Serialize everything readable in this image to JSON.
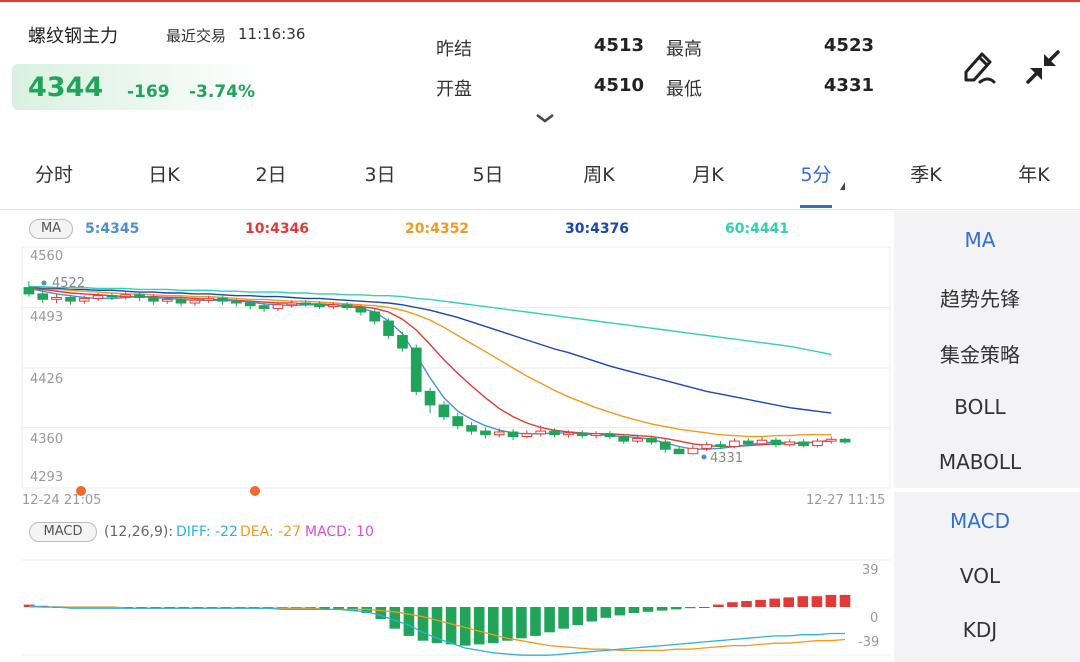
{
  "header": {
    "title": "螺纹钢主力",
    "last_trade_label": "最近交易",
    "last_trade_time": "11:16:36",
    "price": "4344",
    "change": "-169",
    "change_pct": "-3.74%",
    "stats": {
      "prev_settle_label": "昨结",
      "prev_settle_value": "4513",
      "high_label": "最高",
      "high_value": "4523",
      "open_label": "开盘",
      "open_value": "4510",
      "low_label": "最低",
      "low_value": "4331"
    }
  },
  "tabs": [
    "分时",
    "日K",
    "2日",
    "3日",
    "5日",
    "周K",
    "月K",
    "5分",
    "季K",
    "年K"
  ],
  "active_tab": "5分",
  "ma_legend": {
    "badge": "MA",
    "ma5": "5:4345",
    "ma10": "10:4346",
    "ma20": "20:4352",
    "ma30": "30:4376",
    "ma60": "60:4441"
  },
  "price_axis": [
    "4560",
    "4493",
    "4426",
    "4360",
    "4293"
  ],
  "time_axis": {
    "start": "12-24 21:05",
    "end": "12-27 11:15"
  },
  "annotations": {
    "high_mark": "4522",
    "low_mark": "4331"
  },
  "macd": {
    "badge": "MACD",
    "params": "(12,26,9):",
    "diff": "DIFF: -22",
    "dea": "DEA: -27",
    "macd": "MACD: 10",
    "axis": [
      "39",
      "0",
      "-39"
    ]
  },
  "side_panel": {
    "indicators": [
      "MA",
      "趋势先锋",
      "集金策略",
      "BOLL",
      "MABOLL"
    ],
    "sub_indicators": [
      "MACD",
      "VOL",
      "KDJ"
    ],
    "active_indicator": "MA",
    "active_sub_indicator": "MACD"
  },
  "colors": {
    "up": "#e53935",
    "down": "#1fa45a",
    "ma5": "#4a90d9",
    "ma10": "#e53935",
    "ma20": "#f29a1f",
    "ma30": "#1a47b8",
    "ma60": "#2fd3b0",
    "accent": "#2f6fd6"
  },
  "chart_data": {
    "type": "candlestick",
    "interval": "5分",
    "y_range": [
      4293,
      4560
    ],
    "candles": [
      {
        "o": 4515,
        "c": 4508,
        "h": 4522,
        "l": 4505
      },
      {
        "o": 4508,
        "c": 4502,
        "h": 4512,
        "l": 4498
      },
      {
        "o": 4502,
        "c": 4504,
        "h": 4508,
        "l": 4498
      },
      {
        "o": 4504,
        "c": 4500,
        "h": 4507,
        "l": 4496
      },
      {
        "o": 4500,
        "c": 4503,
        "h": 4506,
        "l": 4497
      },
      {
        "o": 4503,
        "c": 4506,
        "h": 4509,
        "l": 4500
      },
      {
        "o": 4506,
        "c": 4505,
        "h": 4509,
        "l": 4501
      },
      {
        "o": 4505,
        "c": 4507,
        "h": 4510,
        "l": 4502
      },
      {
        "o": 4507,
        "c": 4504,
        "h": 4510,
        "l": 4500
      },
      {
        "o": 4504,
        "c": 4500,
        "h": 4507,
        "l": 4496
      },
      {
        "o": 4500,
        "c": 4502,
        "h": 4505,
        "l": 4497
      },
      {
        "o": 4502,
        "c": 4498,
        "h": 4505,
        "l": 4494
      },
      {
        "o": 4498,
        "c": 4501,
        "h": 4504,
        "l": 4495
      },
      {
        "o": 4501,
        "c": 4503,
        "h": 4506,
        "l": 4498
      },
      {
        "o": 4503,
        "c": 4500,
        "h": 4506,
        "l": 4496
      },
      {
        "o": 4500,
        "c": 4498,
        "h": 4503,
        "l": 4494
      },
      {
        "o": 4498,
        "c": 4495,
        "h": 4501,
        "l": 4491
      },
      {
        "o": 4495,
        "c": 4492,
        "h": 4498,
        "l": 4488
      },
      {
        "o": 4492,
        "c": 4496,
        "h": 4499,
        "l": 4489
      },
      {
        "o": 4496,
        "c": 4498,
        "h": 4501,
        "l": 4493
      },
      {
        "o": 4498,
        "c": 4497,
        "h": 4501,
        "l": 4494
      },
      {
        "o": 4497,
        "c": 4494,
        "h": 4500,
        "l": 4491
      },
      {
        "o": 4494,
        "c": 4496,
        "h": 4499,
        "l": 4491
      },
      {
        "o": 4496,
        "c": 4493,
        "h": 4499,
        "l": 4490
      },
      {
        "o": 4493,
        "c": 4488,
        "h": 4496,
        "l": 4484
      },
      {
        "o": 4488,
        "c": 4478,
        "h": 4492,
        "l": 4474
      },
      {
        "o": 4478,
        "c": 4462,
        "h": 4481,
        "l": 4458
      },
      {
        "o": 4462,
        "c": 4448,
        "h": 4466,
        "l": 4444
      },
      {
        "o": 4448,
        "c": 4400,
        "h": 4452,
        "l": 4396
      },
      {
        "o": 4400,
        "c": 4385,
        "h": 4404,
        "l": 4376
      },
      {
        "o": 4385,
        "c": 4372,
        "h": 4389,
        "l": 4368
      },
      {
        "o": 4372,
        "c": 4362,
        "h": 4376,
        "l": 4358
      },
      {
        "o": 4362,
        "c": 4356,
        "h": 4366,
        "l": 4352
      },
      {
        "o": 4356,
        "c": 4352,
        "h": 4360,
        "l": 4348
      },
      {
        "o": 4352,
        "c": 4355,
        "h": 4359,
        "l": 4349
      },
      {
        "o": 4355,
        "c": 4350,
        "h": 4358,
        "l": 4346
      },
      {
        "o": 4350,
        "c": 4353,
        "h": 4357,
        "l": 4348
      },
      {
        "o": 4353,
        "c": 4356,
        "h": 4362,
        "l": 4350
      },
      {
        "o": 4356,
        "c": 4352,
        "h": 4359,
        "l": 4349
      },
      {
        "o": 4352,
        "c": 4354,
        "h": 4357,
        "l": 4349
      },
      {
        "o": 4354,
        "c": 4351,
        "h": 4357,
        "l": 4348
      },
      {
        "o": 4351,
        "c": 4353,
        "h": 4356,
        "l": 4348
      },
      {
        "o": 4353,
        "c": 4350,
        "h": 4356,
        "l": 4347
      },
      {
        "o": 4350,
        "c": 4345,
        "h": 4353,
        "l": 4342
      },
      {
        "o": 4345,
        "c": 4348,
        "h": 4351,
        "l": 4343
      },
      {
        "o": 4348,
        "c": 4344,
        "h": 4351,
        "l": 4341
      },
      {
        "o": 4344,
        "c": 4336,
        "h": 4347,
        "l": 4332
      },
      {
        "o": 4336,
        "c": 4331,
        "h": 4339,
        "l": 4331
      },
      {
        "o": 4331,
        "c": 4337,
        "h": 4341,
        "l": 4331
      },
      {
        "o": 4337,
        "c": 4341,
        "h": 4344,
        "l": 4334
      },
      {
        "o": 4341,
        "c": 4339,
        "h": 4345,
        "l": 4336
      },
      {
        "o": 4339,
        "c": 4345,
        "h": 4348,
        "l": 4337
      },
      {
        "o": 4345,
        "c": 4342,
        "h": 4348,
        "l": 4339
      },
      {
        "o": 4342,
        "c": 4346,
        "h": 4349,
        "l": 4340
      },
      {
        "o": 4346,
        "c": 4341,
        "h": 4349,
        "l": 4338
      },
      {
        "o": 4341,
        "c": 4344,
        "h": 4347,
        "l": 4339
      },
      {
        "o": 4344,
        "c": 4340,
        "h": 4347,
        "l": 4338
      },
      {
        "o": 4340,
        "c": 4345,
        "h": 4348,
        "l": 4338
      },
      {
        "o": 4345,
        "c": 4347,
        "h": 4350,
        "l": 4342
      },
      {
        "o": 4347,
        "c": 4344,
        "h": 4349,
        "l": 4342
      }
    ],
    "ma_series": [
      {
        "name": "5",
        "values": [
          4514,
          4511,
          4508,
          4506,
          4504,
          4503,
          4503,
          4504,
          4505,
          4504,
          4503,
          4502,
          4501,
          4501,
          4501,
          4500,
          4499,
          4497,
          4496,
          4495,
          4496,
          4496,
          4495,
          4494,
          4492,
          4488,
          4478,
          4464,
          4440,
          4415,
          4393,
          4378,
          4369,
          4362,
          4357,
          4354,
          4353,
          4353,
          4354,
          4354,
          4353,
          4352,
          4351,
          4350,
          4349,
          4347,
          4343,
          4339,
          4336,
          4336,
          4337,
          4339,
          4341,
          4343,
          4344,
          4343,
          4343,
          4344,
          4345
        ]
      },
      {
        "name": "10",
        "values": [
          4514,
          4513,
          4511,
          4509,
          4508,
          4507,
          4506,
          4505,
          4505,
          4505,
          4504,
          4504,
          4503,
          4502,
          4502,
          4501,
          4500,
          4499,
          4498,
          4498,
          4497,
          4497,
          4496,
          4495,
          4494,
          4492,
          4488,
          4480,
          4468,
          4452,
          4435,
          4420,
          4406,
          4393,
          4381,
          4372,
          4365,
          4360,
          4357,
          4355,
          4354,
          4353,
          4353,
          4352,
          4351,
          4350,
          4348,
          4345,
          4342,
          4340,
          4339,
          4339,
          4340,
          4341,
          4342,
          4342,
          4343,
          4344,
          4346
        ]
      },
      {
        "name": "20",
        "values": [
          4514,
          4513,
          4513,
          4512,
          4511,
          4510,
          4509,
          4508,
          4508,
          4507,
          4506,
          4506,
          4505,
          4505,
          4504,
          4503,
          4502,
          4502,
          4501,
          4500,
          4500,
          4499,
          4498,
          4497,
          4496,
          4495,
          4493,
          4490,
          4485,
          4479,
          4471,
          4462,
          4453,
          4444,
          4435,
          4426,
          4417,
          4409,
          4401,
          4394,
          4388,
          4382,
          4377,
          4372,
          4368,
          4364,
          4361,
          4358,
          4356,
          4354,
          4352,
          4351,
          4350,
          4350,
          4351,
          4351,
          4352,
          4352,
          4352
        ]
      },
      {
        "name": "30",
        "values": [
          4515,
          4514,
          4514,
          4513,
          4513,
          4512,
          4512,
          4511,
          4510,
          4510,
          4509,
          4509,
          4508,
          4508,
          4507,
          4506,
          4506,
          4505,
          4505,
          4504,
          4503,
          4503,
          4502,
          4501,
          4500,
          4499,
          4498,
          4496,
          4493,
          4490,
          4486,
          4482,
          4477,
          4472,
          4467,
          4462,
          4457,
          4452,
          4447,
          4443,
          4438,
          4433,
          4428,
          4424,
          4420,
          4416,
          4412,
          4408,
          4404,
          4400,
          4397,
          4394,
          4391,
          4388,
          4385,
          4382,
          4380,
          4378,
          4376
        ]
      },
      {
        "name": "60",
        "values": [
          4516,
          4516,
          4515,
          4515,
          4515,
          4514,
          4514,
          4514,
          4513,
          4513,
          4513,
          4512,
          4512,
          4512,
          4511,
          4511,
          4510,
          4510,
          4510,
          4509,
          4509,
          4508,
          4508,
          4507,
          4507,
          4506,
          4506,
          4505,
          4503,
          4502,
          4500,
          4498,
          4496,
          4494,
          4492,
          4490,
          4488,
          4486,
          4484,
          4482,
          4480,
          4478,
          4476,
          4474,
          4472,
          4470,
          4468,
          4466,
          4464,
          4462,
          4460,
          4458,
          4456,
          4454,
          4452,
          4450,
          4447,
          4444,
          4441
        ]
      }
    ],
    "macd": {
      "y_range": [
        -39,
        39
      ],
      "hist": [
        2,
        1,
        0,
        0,
        -1,
        -1,
        0,
        0,
        0,
        0,
        0,
        0,
        -1,
        -1,
        -1,
        -1,
        -1,
        -1,
        -1,
        -1,
        -1,
        -2,
        -2,
        -3,
        -5,
        -10,
        -18,
        -24,
        -28,
        -30,
        -31,
        -32,
        -31,
        -30,
        -28,
        -26,
        -24,
        -21,
        -18,
        -15,
        -12,
        -9,
        -7,
        -5,
        -4,
        -3,
        -2,
        -1,
        0,
        2,
        4,
        5,
        6,
        7,
        8,
        9,
        9,
        10,
        10
      ],
      "diff": [
        1,
        0,
        0,
        -1,
        -1,
        -1,
        -1,
        -1,
        -1,
        -1,
        -1,
        -1,
        -1,
        -1,
        -1,
        -1,
        -1,
        -1,
        -2,
        -2,
        -2,
        -2,
        -2,
        -3,
        -4,
        -7,
        -11,
        -15,
        -21,
        -26,
        -30,
        -34,
        -36,
        -38,
        -39,
        -40,
        -40,
        -40,
        -39,
        -38,
        -37,
        -36,
        -35,
        -34,
        -33,
        -32,
        -31,
        -30,
        -29,
        -28,
        -27,
        -26,
        -25,
        -24,
        -24,
        -23,
        -23,
        -22,
        -22
      ],
      "dea": [
        0,
        0,
        0,
        0,
        0,
        0,
        0,
        -1,
        -1,
        -1,
        -1,
        -1,
        -1,
        -1,
        -1,
        -1,
        -1,
        -1,
        -1,
        -1,
        -1,
        -2,
        -2,
        -2,
        -2,
        -3,
        -4,
        -6,
        -8,
        -11,
        -14,
        -17,
        -20,
        -23,
        -26,
        -28,
        -30,
        -32,
        -33,
        -34,
        -35,
        -35,
        -36,
        -36,
        -36,
        -36,
        -35,
        -35,
        -34,
        -33,
        -32,
        -32,
        -31,
        -30,
        -30,
        -29,
        -28,
        -28,
        -27
      ]
    }
  }
}
